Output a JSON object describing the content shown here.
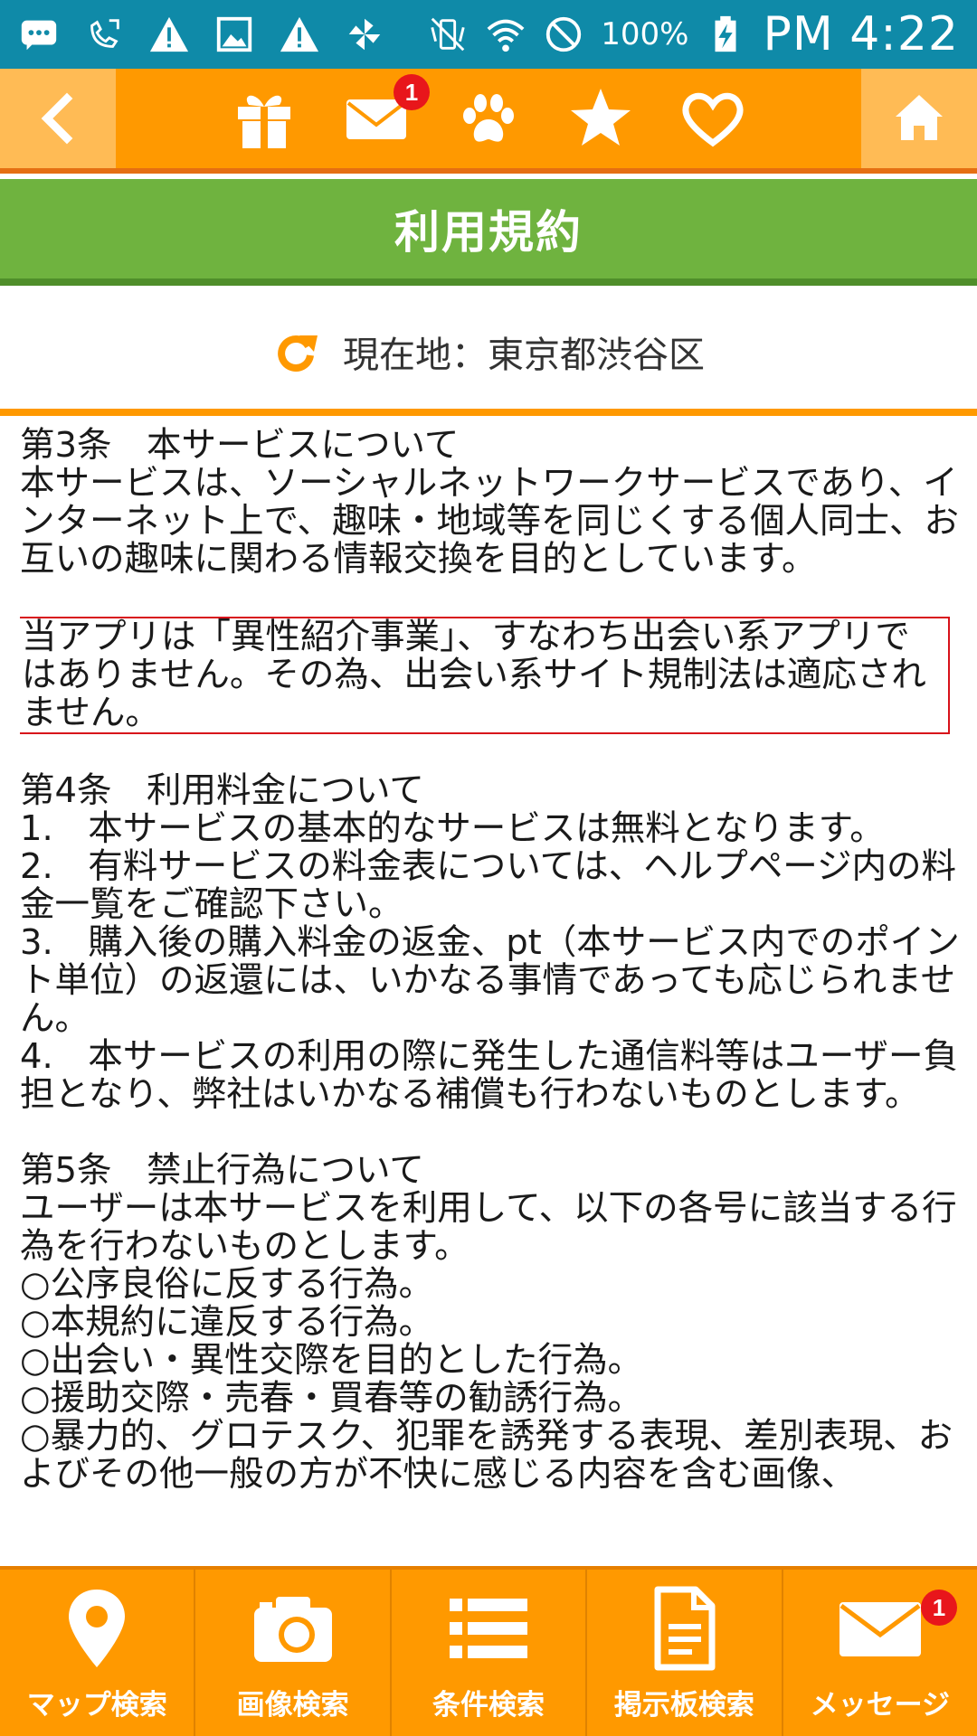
{
  "status_bar": {
    "battery": "100%",
    "time": "PM 4:22"
  },
  "top_nav": {
    "message_badge": "1"
  },
  "title": "利用規約",
  "location": {
    "text": "現在地：東京都渋谷区"
  },
  "terms": {
    "article3_heading": "第3条　本サービスについて",
    "article3_body": "本サービスは、ソーシャルネットワークサービスであり、インターネット上で、趣味・地域等を同じくする個人同士、お互いの趣味に関わる情報交換を目的としています。",
    "notice": "当アプリは「異性紹介事業」、すなわち出会い系アプリではありません。その為、出会い系サイト規制法は適応されません。",
    "article4_heading": "第4条　利用料金について",
    "article4_items": [
      "1.　本サービスの基本的なサービスは無料となります。",
      "2.　有料サービスの料金表については、ヘルプページ内の料金一覧をご確認下さい。",
      "3.　購入後の購入料金の返金、pt（本サービス内でのポイント単位）の返還には、いかなる事情であっても応じられません。",
      "4.　本サービスの利用の際に発生した通信料等はユーザー負担となり、弊社はいかなる補償も行わないものとします。"
    ],
    "article5_heading": "第5条　禁止行為について",
    "article5_body": "ユーザーは本サービスを利用して、以下の各号に該当する行為を行わないものとします。",
    "article5_items": [
      "○公序良俗に反する行為。",
      "○本規約に違反する行為。",
      "○出会い・異性交際を目的とした行為。",
      "○援助交際・売春・買春等の勧誘行為。",
      "○暴力的、グロテスク、犯罪を誘発する表現、差別表現、およびその他一般の方が不快に感じる内容を含む画像、"
    ]
  },
  "bottom_nav": {
    "tabs": [
      {
        "label": "マップ検索"
      },
      {
        "label": "画像検索"
      },
      {
        "label": "条件検索"
      },
      {
        "label": "掲示板検索"
      },
      {
        "label": "メッセージ",
        "badge": "1"
      }
    ]
  },
  "colors": {
    "status_bar": "#0f8aa8",
    "nav_orange": "#ff9900",
    "nav_light": "#ffbb55",
    "title_green": "#6fb33f",
    "badge_red": "#e8161b",
    "notice_border": "#d8121a"
  }
}
